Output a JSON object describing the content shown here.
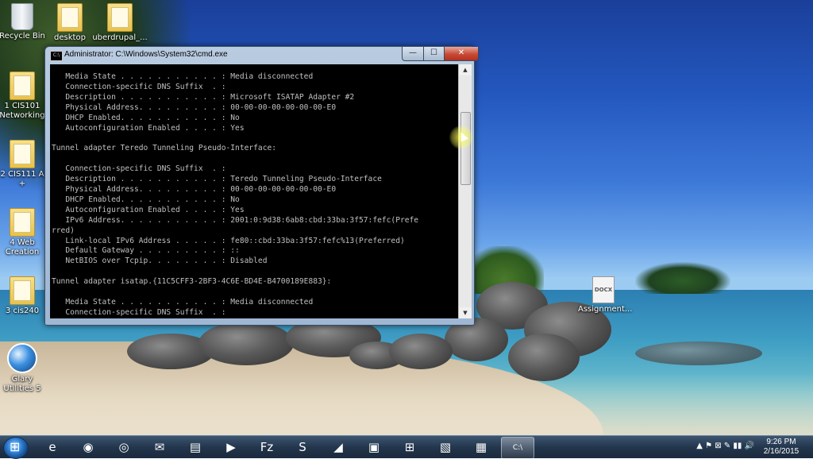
{
  "desktop": {
    "icons": [
      {
        "label": "Recycle Bin"
      },
      {
        "label": "desktop"
      },
      {
        "label": "uberdrupal_..."
      },
      {
        "label": "1 CIS101 Networking"
      },
      {
        "label": "2 CIS111 A +"
      },
      {
        "label": "4 Web Creation"
      },
      {
        "label": "3 cis240"
      },
      {
        "label": "Glary Utilities 5"
      },
      {
        "label": "Assignment..."
      }
    ],
    "docx_badge": "DOCX"
  },
  "cmd_window": {
    "title": "Administrator: C:\\Windows\\System32\\cmd.exe",
    "icon_text": "C:\\",
    "buttons": {
      "minimize": "—",
      "maximize": "☐",
      "close": "✕"
    },
    "output": [
      "   Media State . . . . . . . . . . . : Media disconnected",
      "   Connection-specific DNS Suffix  . :",
      "   Description . . . . . . . . . . . : Microsoft ISATAP Adapter #2",
      "   Physical Address. . . . . . . . . : 00-00-00-00-00-00-00-E0",
      "   DHCP Enabled. . . . . . . . . . . : No",
      "   Autoconfiguration Enabled . . . . : Yes",
      "",
      "Tunnel adapter Teredo Tunneling Pseudo-Interface:",
      "",
      "   Connection-specific DNS Suffix  . :",
      "   Description . . . . . . . . . . . : Teredo Tunneling Pseudo-Interface",
      "   Physical Address. . . . . . . . . : 00-00-00-00-00-00-00-E0",
      "   DHCP Enabled. . . . . . . . . . . : No",
      "   Autoconfiguration Enabled . . . . : Yes",
      "   IPv6 Address. . . . . . . . . . . : 2001:0:9d38:6ab8:cbd:33ba:3f57:fefc(Prefe",
      "rred)",
      "   Link-local IPv6 Address . . . . . : fe80::cbd:33ba:3f57:fefc%13(Preferred)",
      "   Default Gateway . . . . . . . . . : ::",
      "   NetBIOS over Tcpip. . . . . . . . : Disabled",
      "",
      "Tunnel adapter isatap.{11C5CFF3-2BF3-4C6E-BD4E-B4700189E883}:",
      "",
      "   Media State . . . . . . . . . . . : Media disconnected",
      "   Connection-specific DNS Suffix  . :"
    ]
  },
  "taskbar": {
    "apps": [
      {
        "name": "internet-explorer",
        "glyph": "e"
      },
      {
        "name": "firefox",
        "glyph": "◉"
      },
      {
        "name": "chrome",
        "glyph": "◎"
      },
      {
        "name": "thunderbird",
        "glyph": "✉"
      },
      {
        "name": "file-explorer",
        "glyph": "▤"
      },
      {
        "name": "media-player",
        "glyph": "▶"
      },
      {
        "name": "filezilla",
        "glyph": "Fz"
      },
      {
        "name": "app-s",
        "glyph": "S"
      },
      {
        "name": "wireshark",
        "glyph": "◢"
      },
      {
        "name": "presentation",
        "glyph": "▣"
      },
      {
        "name": "network",
        "glyph": "⊞"
      },
      {
        "name": "sticky-notes",
        "glyph": "▧"
      },
      {
        "name": "window-app",
        "glyph": "▦"
      },
      {
        "name": "cmd",
        "glyph": "C:\\"
      }
    ],
    "tray_glyphs": "▲  ⚑  ⊠  ✎  ▮▮  🔊",
    "time": "9:26 PM",
    "date": "2/16/2015"
  }
}
